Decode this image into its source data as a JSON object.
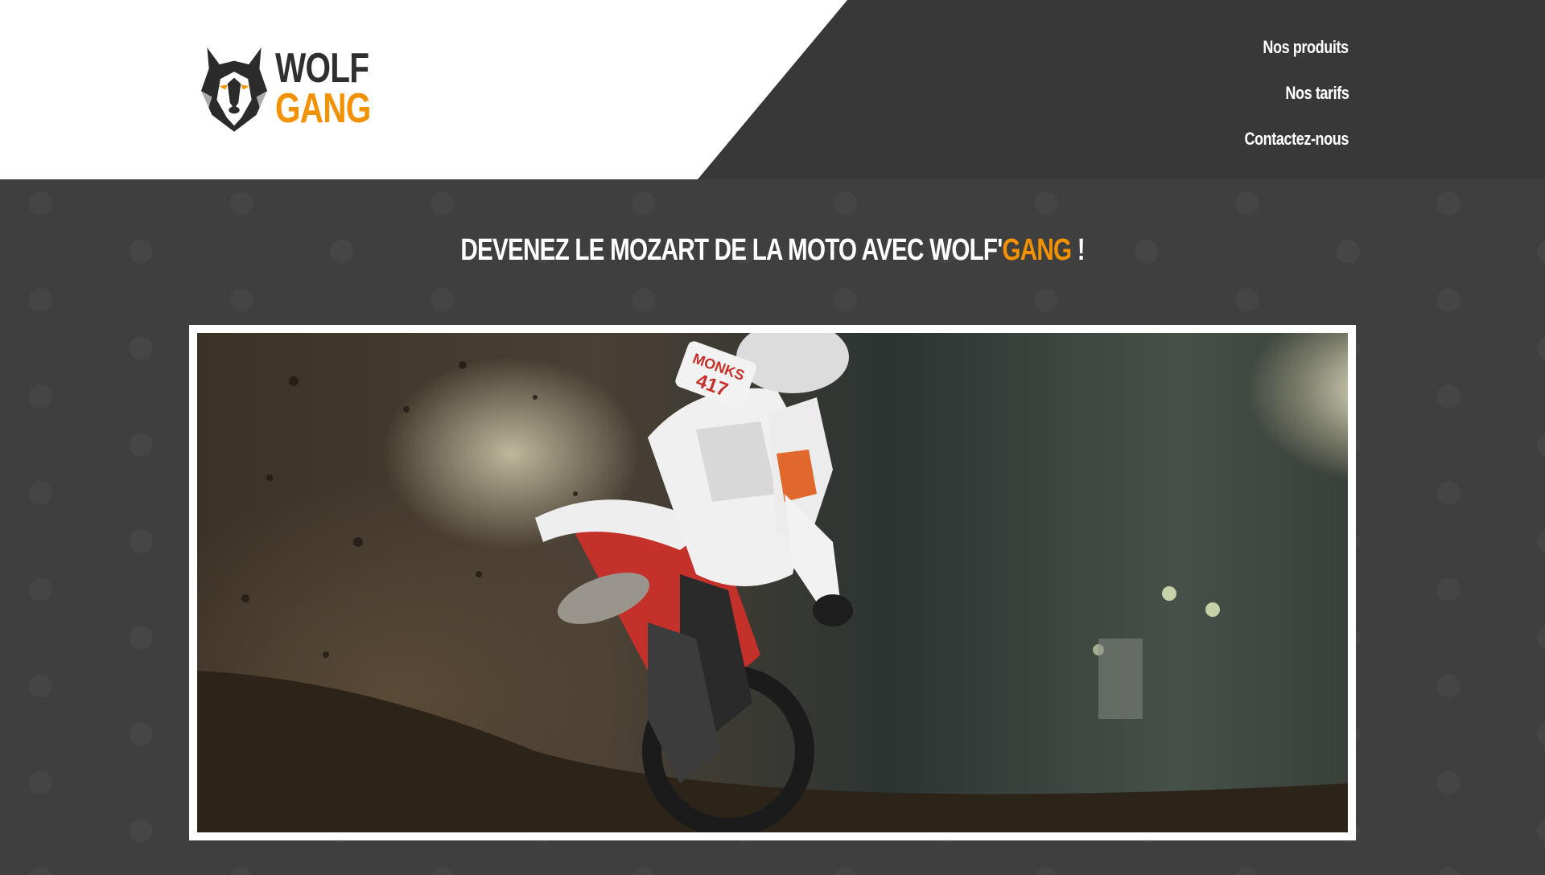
{
  "logo": {
    "line1": "WOLF",
    "line2": "GANG",
    "icon": "wolf-head-icon"
  },
  "nav": {
    "items": [
      {
        "label": "Nos produits"
      },
      {
        "label": "Nos tarifs"
      },
      {
        "label": "Contactez-nous"
      }
    ]
  },
  "hero": {
    "headline_prefix": "DEVENEZ LE MOZART DE LA MOTO AVEC WOLF'",
    "headline_accent": "GANG",
    "headline_suffix": " !",
    "image": {
      "subject": "motocross rider",
      "number_plate": "MONKS 417"
    }
  },
  "colors": {
    "accent": "#f39200",
    "header_dark": "#383838",
    "page_bg": "#3f3f3f"
  }
}
